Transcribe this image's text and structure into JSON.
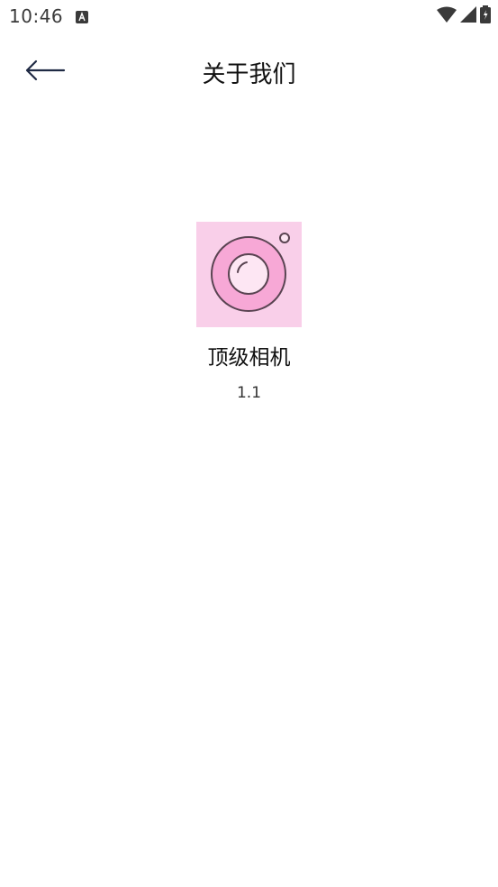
{
  "status_bar": {
    "time": "10:46",
    "icons": [
      "notification-a-icon",
      "wifi-icon",
      "cell-signal-icon",
      "battery-charging-icon"
    ]
  },
  "header": {
    "title": "关于我们",
    "back_icon": "arrow-left-icon"
  },
  "app": {
    "name": "顶级相机",
    "version": "1.1",
    "icon": "camera-lens-icon",
    "colors": {
      "icon_background": "#f9cfe9",
      "lens_ring": "#f7a8d6",
      "lens_inner": "#fde6f3",
      "outline": "#5a4452"
    }
  }
}
